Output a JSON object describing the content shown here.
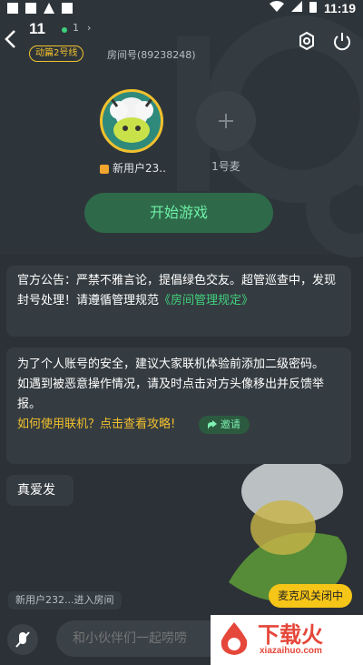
{
  "status_bar": {
    "time": "11:19"
  },
  "header": {
    "room_title": "11",
    "online_count": "1",
    "online_chevron": "›",
    "line_badge": "动篇2号线",
    "room_id": "房间号(89238248)"
  },
  "seats": [
    {
      "label": "新用户23..",
      "is_host": true
    },
    {
      "label": "1号麦",
      "is_host": false
    }
  ],
  "start_button": "开始游戏",
  "announcement": {
    "text": "官方公告：严禁不雅言论，提倡绿色交友。超管巡查中，发现封号处理！请遵循管理规范",
    "link": "《房间管理规定》"
  },
  "tips": {
    "line1": "为了个人账号的安全，建议大家联机体验前添加二级密码。",
    "line2": "如遇到被恶意操作情况，请及时点击对方头像移出并反馈举报。",
    "link": "如何使用联机？点击查看攻略!",
    "invite": "邀请"
  },
  "chat_message": "真爱发",
  "system_message": "新用户232...进入房间",
  "mic_status": "麦克风关闭中",
  "input": {
    "placeholder": "和小伙伴们一起唠唠"
  },
  "watermark": {
    "text": "下载火",
    "url": "xiazaihuo.com"
  },
  "colors": {
    "accent_green": "#3fd27d",
    "accent_yellow": "#f2c12e",
    "background": "#2b3136"
  }
}
